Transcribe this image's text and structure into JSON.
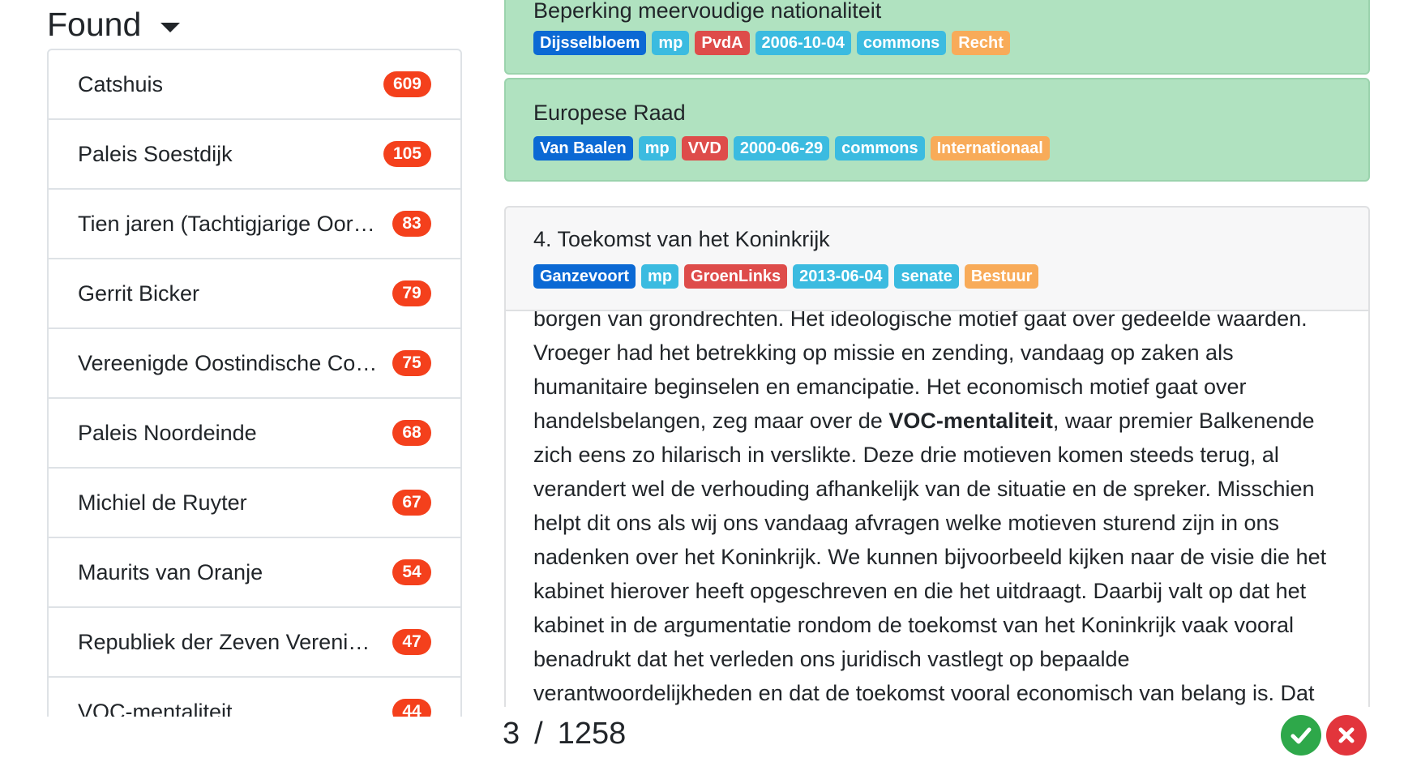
{
  "found": {
    "title": "Found",
    "items": [
      {
        "label": "Catshuis",
        "count": "609"
      },
      {
        "label": "Paleis Soestdijk",
        "count": "105"
      },
      {
        "label": "Tien jaren (Tachtigjarige Oorl…",
        "count": "83"
      },
      {
        "label": "Gerrit Bicker",
        "count": "79"
      },
      {
        "label": "Vereenigde Oostindische Co…",
        "count": "75"
      },
      {
        "label": "Paleis Noordeinde",
        "count": "68"
      },
      {
        "label": "Michiel de Ruyter",
        "count": "67"
      },
      {
        "label": "Maurits van Oranje",
        "count": "54"
      },
      {
        "label": "Republiek der Zeven Verenig…",
        "count": "47"
      },
      {
        "label": "VOC-mentaliteit",
        "count": "44"
      }
    ]
  },
  "results": [
    {
      "title": "Beperking meervoudige nationaliteit",
      "tags": [
        "Dijsselbloem",
        "mp",
        "PvdA",
        "2006-10-04",
        "commons",
        "Recht"
      ]
    },
    {
      "title": "Europese Raad",
      "tags": [
        "Van Baalen",
        "mp",
        "VVD",
        "2000-06-29",
        "commons",
        "Internationaal"
      ]
    },
    {
      "title": "4. Toekomst van het Koninkrijk",
      "tags": [
        "Ganzevoort",
        "mp",
        "GroenLinks",
        "2013-06-04",
        "senate",
        "Bestuur"
      ]
    }
  ],
  "excerpt": {
    "before": "borgen van grondrechten. Het ideologische motief gaat over gedeelde waarden. Vroeger had het betrekking op missie en zending, vandaag op zaken als humanitaire beginselen en emancipatie. Het economisch motief gaat over handelsbelangen, zeg maar over de ",
    "highlight": "VOC-mentaliteit",
    "after": ", waar premier Balkenende zich eens zo hilarisch in verslikte. Deze drie motieven komen steeds terug, al verandert wel de verhouding afhankelijk van de situatie en de spreker. Misschien helpt dit ons als wij ons vandaag afvragen welke motieven sturend zijn in ons nadenken over het Koninkrijk. We kunnen bijvoorbeeld kijken naar de visie die het kabinet hierover heeft opgeschreven en die het uitdraagt. Daarbij valt op dat het kabinet in de argumentatie rondom de toekomst van het Koninkrijk vaak vooral benadrukt dat het verleden ons juridisch vastlegt op bepaalde verantwoordelijkheden en dat de toekomst vooral economisch van belang is. Dat"
  },
  "pager": {
    "current": "3",
    "separator": "/",
    "total": "1258"
  },
  "icons": {
    "accept": "check-circle-icon",
    "reject": "x-circle-icon"
  },
  "colors": {
    "speaker": "#0b69d4",
    "role": "#3bbbe0",
    "party": "#de4c4a",
    "date": "#3bbbe0",
    "house": "#3bbbe0",
    "topic": "#f8ab59",
    "count_pill": "#f4401c",
    "accept": "#2ea84a",
    "reject": "#e2353c",
    "matched_card": "#b0e2c0"
  }
}
